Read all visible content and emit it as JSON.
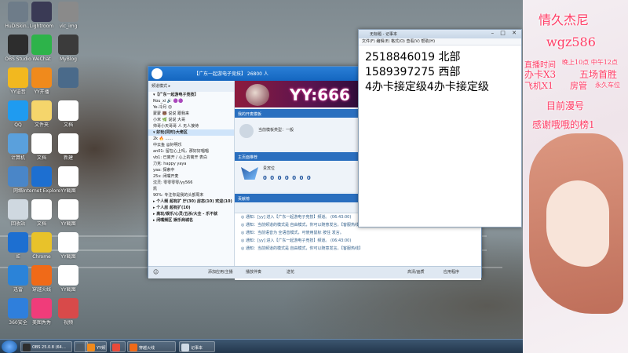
{
  "desktop": {
    "icons": [
      {
        "label": "HuDiSkin…",
        "color": "#6e7c89"
      },
      {
        "label": "Lightroom",
        "color": "#3a3a55"
      },
      {
        "label": "vlc_img",
        "color": "#8a8a8a"
      },
      {
        "label": "OBS Studio",
        "color": "#2d2d2d"
      },
      {
        "label": "WeChat",
        "color": "#2db34a"
      },
      {
        "label": "MyBlog",
        "color": "#3b3b3b"
      },
      {
        "label": "YY语音",
        "color": "#f2b81f"
      },
      {
        "label": "YY开播",
        "color": "#f08a1c"
      },
      {
        "label": "",
        "color": "#4a6a8a"
      },
      {
        "label": "QQ",
        "color": "#1f9bf0"
      },
      {
        "label": "文件夹",
        "color": "#f5d56b"
      },
      {
        "label": "文档",
        "color": "#ffffff"
      },
      {
        "label": "计算机",
        "color": "#5aa0dc"
      },
      {
        "label": "文档",
        "color": "#ffffff"
      },
      {
        "label": "新建",
        "color": "#ffffff"
      },
      {
        "label": "网络",
        "color": "#4a86c8"
      },
      {
        "label": "Internet Explorer",
        "color": "#1d6fd1"
      },
      {
        "label": "YY截图",
        "color": "#ffffff"
      },
      {
        "label": "回收站",
        "color": "#cfd8e0"
      },
      {
        "label": "文档",
        "color": "#ffffff"
      },
      {
        "label": "YY截图",
        "color": "#ffffff"
      },
      {
        "label": "IE",
        "color": "#1d6fd1"
      },
      {
        "label": "Chrome",
        "color": "#e8c22a"
      },
      {
        "label": "YY截图",
        "color": "#ffffff"
      },
      {
        "label": "迅雷",
        "color": "#2b83d8"
      },
      {
        "label": "穿越火线",
        "color": "#f06a18"
      },
      {
        "label": "YY截图",
        "color": "#ffffff"
      },
      {
        "label": "360安全",
        "color": "#2f7fdc"
      },
      {
        "label": "美图秀秀",
        "color": "#f03c7a"
      },
      {
        "label": "视频",
        "color": "#d84a4a"
      }
    ]
  },
  "qq_window": {
    "title": "【广东一起游电子竞技】 26800 人",
    "left_header": "频道模式 ▸",
    "channels": [
      {
        "label": "▾【广东一起游电子竞技】",
        "group": true,
        "selected": false
      },
      {
        "label": "  Rou_xi 🔊 🟣🟣",
        "group": false,
        "selected": false
      },
      {
        "label": "  Ye-冷月 😊",
        "group": false,
        "selected": false
      },
      {
        "label": "  蒙蒙 🐻 说说 跟我来",
        "group": false,
        "selected": false
      },
      {
        "label": "  小米 🌿 说说 大哥",
        "group": false,
        "selected": false
      },
      {
        "label": "  帅哥小天哥哥 人 无人接待",
        "group": false,
        "selected": false
      },
      {
        "label": "▾ 好玩(同时)大佬区",
        "group": true,
        "selected": true
      },
      {
        "label": "  2k 🔥 ......",
        "group": false,
        "selected": false
      },
      {
        "label": "  中云鱼 @好明乐",
        "group": false,
        "selected": false
      },
      {
        "label": "  an01: 留在心上吗，那好好唱唱",
        "group": false,
        "selected": false
      },
      {
        "label": "  vb1: 已离开 / 心上的离开 表白",
        "group": false,
        "selected": false
      },
      {
        "label": "  力克: happy yaya",
        "group": false,
        "selected": false
      },
      {
        "label": "  yaa: 探索中",
        "group": false,
        "selected": false
      },
      {
        "label": "  25v: 闭嘴开麦",
        "group": false,
        "selected": false
      },
      {
        "label": "  沈灵: 零零零零/yy566",
        "group": false,
        "selected": false
      },
      {
        "label": "  凯",
        "group": false,
        "selected": false
      },
      {
        "label": "  90%: 专注你是我的头部周末",
        "group": false,
        "selected": false
      },
      {
        "label": "▸ 个人频 超有扩 厅(30) 房态(10) 欢迎(10)",
        "group": true,
        "selected": false
      },
      {
        "label": "▸ 个人房 超有扩(10)",
        "group": true,
        "selected": false
      },
      {
        "label": "▸ 高玩/娱乐/心灵/五杀/大全 - 乐不就",
        "group": true,
        "selected": false
      },
      {
        "label": "",
        "group": false,
        "selected": false
      },
      {
        "label": "▸ 闭嘴频区 娱乐商城名",
        "group": true,
        "selected": false
      }
    ],
    "banner_text": "YY:666",
    "pane1": {
      "title": "我的开麦模板",
      "text": "当前模板类型：一般"
    },
    "pane2": {
      "title": "主页面推荐",
      "text": "贵宾位",
      "badge": "0 0 0 0 0 0 0"
    },
    "pane3": {
      "title": "贡献榜"
    },
    "messages": [
      "◎ 通知：[yy] 进入【广东一起游电子竞技】频道。 (06:43:00)",
      "◎ 通知：当前频道的模式是 自由模式，你可以随意发言。【客服热线】",
      "◎ 通知：当前语音为 全语音模式，可使用鼠标 按住 发言。",
      "◎ 通知：[yy] 进入【广东一起游电子竞技】频道。 (06:43:00)",
      "◎ 通知：当前频道的模式是 自由模式，你可以随意发言。【客服热线】"
    ],
    "input_placeholder": "我什么哦...",
    "bottom": {
      "apps": "添加应用/主播",
      "music": "播放伴奏",
      "gift": "送花",
      "mode": "高清/画质",
      "settings": "应用程序"
    }
  },
  "notepad": {
    "title": "无标题 - 记事本",
    "menu": "文件(F)  编辑(E)  格式(O)  查看(V)  帮助(H)",
    "lines": [
      "2518846019  北部",
      "1589397275   西部",
      "4办卡接定级4办卡接定级"
    ]
  },
  "overlay": {
    "name": "情久杰尼",
    "id": "wgz586",
    "schedule_label": "直播时间",
    "schedule_time": "晚上10点 中午12点",
    "line1a": "办卡X3",
    "line1b": "五场首胜",
    "line2a": "飞机X1",
    "line2b": "房管",
    "line2c": "永久车位",
    "status": "目前漫号",
    "thanks": "感谢哦哦的榜1"
  },
  "taskbar": {
    "tasks": [
      {
        "label": "OBS 25.0.8 (64…",
        "color": "#2d2d2d"
      },
      {
        "label": "",
        "color": "#4b5a68"
      },
      {
        "label": "YY频道…",
        "color": "#f08a1c"
      },
      {
        "label": "",
        "color": "#e84a3a"
      },
      {
        "label": "穿越火线",
        "color": "#f06a18"
      },
      {
        "label": "记事本",
        "color": "#d0dbe6"
      }
    ]
  }
}
